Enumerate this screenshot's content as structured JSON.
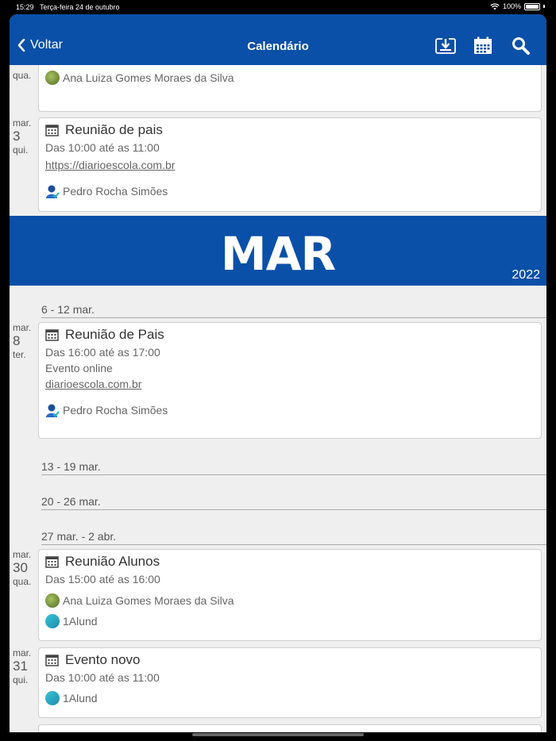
{
  "status_bar": {
    "time": "15:29",
    "date": "Terça-feira 24 de outubro",
    "battery": "100%"
  },
  "navbar": {
    "back_label": "Voltar",
    "title": "Calendário"
  },
  "partial_top": {
    "weekday": "qua.",
    "person": "Ana Luiza Gomes Moraes da Silva"
  },
  "events": [
    {
      "month": "mar.",
      "day": "3",
      "weekday": "qui.",
      "title": "Reunião de pais",
      "time": "Das 10:00 até as 11:00",
      "link": "https://diarioescola.com.br",
      "person": "Pedro Rocha Simões"
    },
    {
      "month": "mar.",
      "day": "8",
      "weekday": "ter.",
      "title": "Reunião de Pais",
      "time": "Das 16:00 até as 17:00",
      "location": "Evento online",
      "link": "diarioescola.com.br",
      "person": "Pedro Rocha Simões"
    },
    {
      "month": "mar.",
      "day": "30",
      "weekday": "qua.",
      "title": "Reunião Alunos",
      "time": "Das 15:00 até as 16:00",
      "person": "Ana Luiza Gomes Moraes da Silva",
      "group": "1Alund"
    },
    {
      "month": "mar.",
      "day": "31",
      "weekday": "qui.",
      "title": "Evento novo",
      "time": "Das 10:00 até as 11:00",
      "group": "1Alund"
    }
  ],
  "month_banner": {
    "month": "MAR",
    "year": "2022"
  },
  "weeks": [
    "6 - 12 mar.",
    "13 - 19 mar.",
    "20 - 26 mar.",
    "27 mar. - 2 abr."
  ],
  "colors": {
    "brand_blue": "#0a50a8",
    "background": "#efefef"
  }
}
